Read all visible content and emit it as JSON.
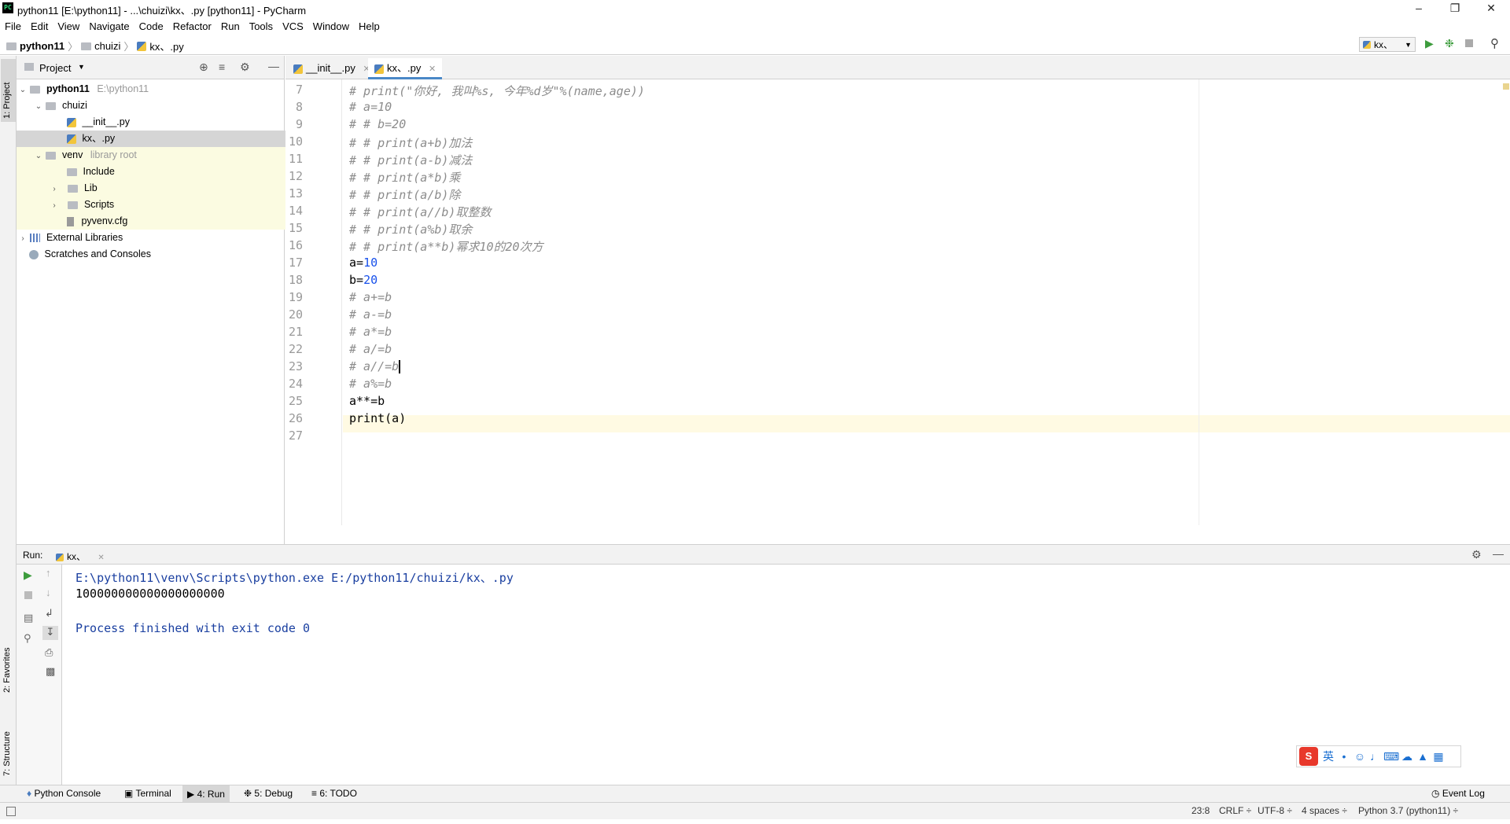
{
  "window": {
    "title": "python11 [E:\\python11] - ...\\chuizi\\kx、.py [python11] - PyCharm",
    "app_icon": "PC"
  },
  "menu": [
    "File",
    "Edit",
    "View",
    "Navigate",
    "Code",
    "Refactor",
    "Run",
    "Tools",
    "VCS",
    "Window",
    "Help"
  ],
  "breadcrumb": {
    "project": "python11",
    "folder": "chuizi",
    "file": "kx、.py"
  },
  "run_config": {
    "name": "kx、"
  },
  "left_stripe": {
    "project": "1: Project",
    "favorites": "2: Favorites",
    "structure": "7: Structure"
  },
  "project_panel": {
    "title": "Project",
    "tree": [
      {
        "label": "python11",
        "suffix": "E:\\python11"
      },
      {
        "label": "chuizi"
      },
      {
        "label": "__init__.py"
      },
      {
        "label": "kx、.py"
      },
      {
        "label": "venv",
        "suffix": "library root"
      },
      {
        "label": "Include"
      },
      {
        "label": "Lib"
      },
      {
        "label": "Scripts"
      },
      {
        "label": "pyvenv.cfg"
      },
      {
        "label": "External Libraries"
      },
      {
        "label": "Scratches and Consoles"
      }
    ]
  },
  "editor": {
    "tabs": [
      {
        "label": "__init__.py",
        "active": false
      },
      {
        "label": "kx、.py",
        "active": true
      }
    ],
    "current_line": 23,
    "lines": [
      {
        "n": "7",
        "text": "# print(\"你好, 我叫%s, 今年%d岁\"%(name,age))"
      },
      {
        "n": "8",
        "text": "# a=10"
      },
      {
        "n": "9",
        "text": "# # b=20"
      },
      {
        "n": "10",
        "text": "# # print(a+b)加法"
      },
      {
        "n": "11",
        "text": "# # print(a-b)减法"
      },
      {
        "n": "12",
        "text": "# # print(a*b)乘"
      },
      {
        "n": "13",
        "text": "# # print(a/b)除"
      },
      {
        "n": "14",
        "text": "# # print(a//b)取整数"
      },
      {
        "n": "15",
        "text": "# # print(a%b)取余"
      },
      {
        "n": "16",
        "text": "# # print(a**b)幂求10的20次方"
      },
      {
        "n": "17",
        "text": "a=",
        "num": "10"
      },
      {
        "n": "18",
        "text": "b=",
        "num": "20"
      },
      {
        "n": "19",
        "text": "# a+=b"
      },
      {
        "n": "20",
        "text": "# a-=b"
      },
      {
        "n": "21",
        "text": "# a*=b"
      },
      {
        "n": "22",
        "text": "# a/=b"
      },
      {
        "n": "23",
        "text": "# a//=b"
      },
      {
        "n": "24",
        "text": "# a%=b"
      },
      {
        "n": "25",
        "text": "a**=b"
      },
      {
        "n": "26",
        "text": "print(a)"
      },
      {
        "n": "27",
        "text": ""
      }
    ]
  },
  "run_panel": {
    "label": "Run:",
    "tab": "kx、",
    "output": [
      {
        "text": "E:\\python11\\venv\\Scripts\\python.exe E:/python11/chuizi/kx、.py",
        "color": "#1a3fa0"
      },
      {
        "text": "100000000000000000000",
        "color": "#000000"
      },
      {
        "text": "",
        "color": "#000000"
      },
      {
        "text": "Process finished with exit code 0",
        "color": "#1a3fa0"
      }
    ]
  },
  "bottom_tabs": [
    "Python Console",
    "Terminal",
    "4: Run",
    "5: Debug",
    "6: TODO"
  ],
  "event_log": "Event Log",
  "status": {
    "position": "23:8",
    "line_sep": "CRLF ÷",
    "encoding": "UTF-8 ÷",
    "indent": "4 spaces ÷",
    "interpreter": "Python 3.7 (python11) ÷"
  },
  "ime": {
    "lang": "英"
  }
}
